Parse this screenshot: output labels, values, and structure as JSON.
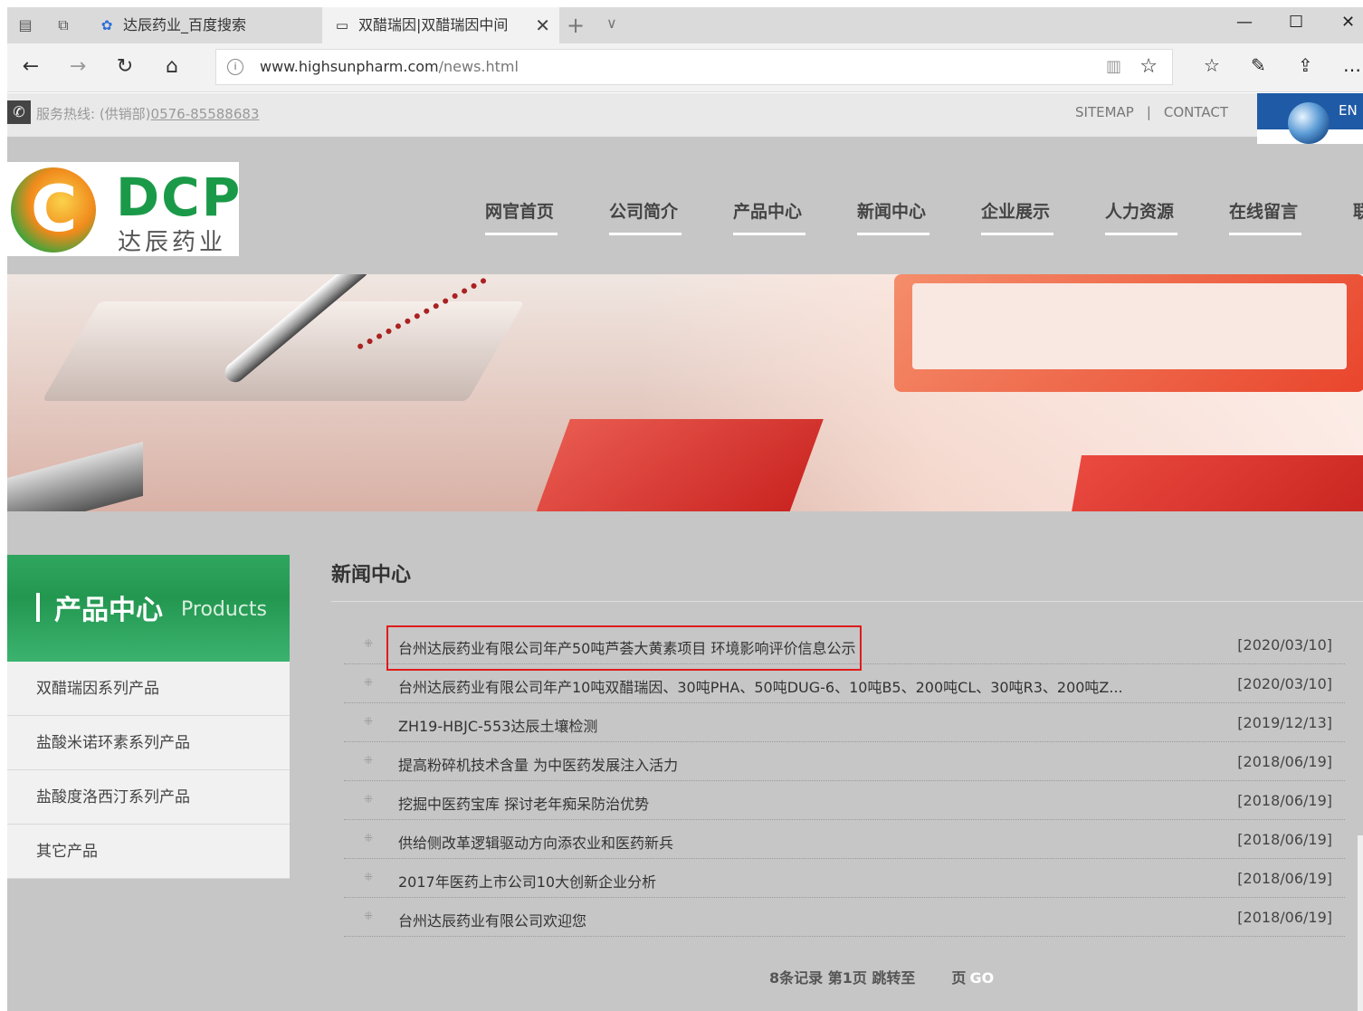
{
  "browser": {
    "tabs": [
      {
        "label": "达辰药业_百度搜索",
        "icon": "paw-icon"
      },
      {
        "label": "双醋瑞因|双醋瑞因中间",
        "icon": "page-icon",
        "active": true
      }
    ],
    "url_host": "www.highsunpharm.com",
    "url_path": "/news.html"
  },
  "site": {
    "hotline_label": "服务热线: (供销部)",
    "hotline_number": "0576-85588683",
    "top_links": [
      "SITEMAP",
      "|",
      "CONTACT"
    ],
    "lang_label": "EN",
    "logo_text": "DCP",
    "logo_cn": "达辰药业",
    "nav": [
      "网官首页",
      "公司简介",
      "产品中心",
      "新闻中心",
      "企业展示",
      "人力资源",
      "在线留言",
      "联"
    ]
  },
  "sidebar": {
    "title": "产品中心",
    "title_en": "Products",
    "items": [
      "双醋瑞因系列产品",
      "盐酸米诺环素系列产品",
      "盐酸度洛西汀系列产品",
      "其它产品"
    ]
  },
  "content": {
    "title": "新闻中心",
    "news": [
      {
        "title": "台州达辰药业有限公司年产50吨芦荟大黄素项目 环境影响评价信息公示",
        "date": "[2020/03/10]"
      },
      {
        "title": "台州达辰药业有限公司年产10吨双醋瑞因、30吨PHA、50吨DUG-6、10吨B5、200吨CL、30吨R3、200吨Z...",
        "date": "[2020/03/10]"
      },
      {
        "title": "ZH19-HBJC-553达辰土壤检测",
        "date": "[2019/12/13]"
      },
      {
        "title": "提高粉碎机技术含量 为中医药发展注入活力",
        "date": "[2018/06/19]"
      },
      {
        "title": "挖掘中医药宝库 探讨老年痴呆防治优势",
        "date": "[2018/06/19]"
      },
      {
        "title": "供给侧改革逻辑驱动方向添农业和医药新兵",
        "date": "[2018/06/19]"
      },
      {
        "title": "2017年医药上市公司10大创新企业分析",
        "date": "[2018/06/19]"
      },
      {
        "title": "台州达辰药业有限公司欢迎您",
        "date": "[2018/06/19]"
      }
    ],
    "pager": {
      "summary": "8条记录 第1页 跳转至",
      "page_suffix": "页",
      "go": "GO"
    }
  },
  "colors": {
    "highlight": "#e01b1b",
    "brand_green": "#1a9a48",
    "lang_blue": "#1f5aa6"
  }
}
